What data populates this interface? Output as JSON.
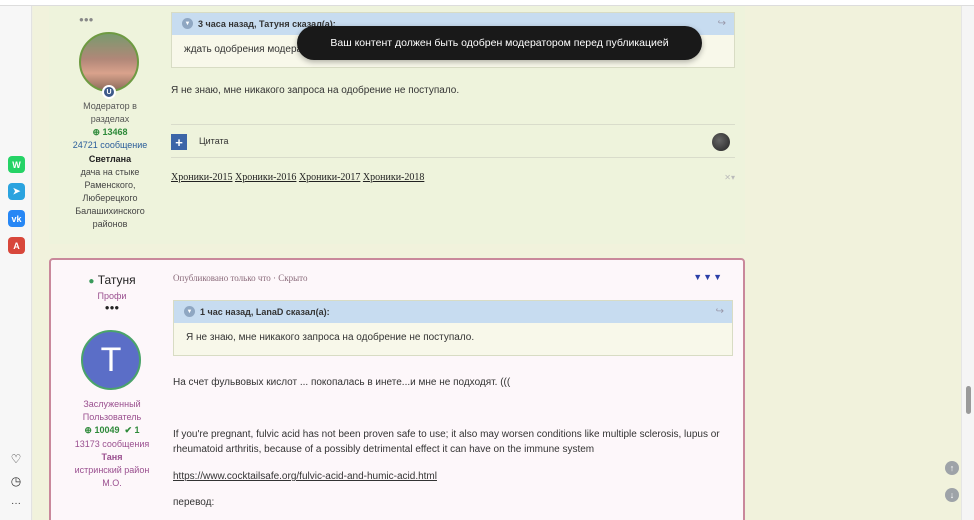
{
  "toast": {
    "message": "Ваш контент должен быть одобрен модератором перед публикацией"
  },
  "sidebar": {
    "apps": [
      {
        "icon": "whatsapp-icon",
        "glyph": "W",
        "color": "#25d366"
      },
      {
        "icon": "telegram-icon",
        "glyph": "➤",
        "color": "#2aa3df"
      },
      {
        "icon": "vk-icon",
        "glyph": "vk",
        "color": "#2787f5"
      },
      {
        "icon": "pdf-icon",
        "glyph": "A",
        "color": "#d8473b"
      }
    ],
    "bottom": [
      {
        "icon": "heart-icon",
        "glyph": "♡"
      },
      {
        "icon": "clock-icon",
        "glyph": "◷"
      },
      {
        "icon": "more-icon",
        "glyph": "···"
      }
    ]
  },
  "post1": {
    "author": {
      "role": "Модератор в разделах",
      "reputation": "13468",
      "posts": "24721 сообщение",
      "name": "Светлана",
      "location": "дача на стыке Раменского, Люберецкого Балашихинского районов"
    },
    "quote": {
      "header": "3 часа назад, Татуня сказал(а):",
      "body": "ждать одобрения модератора"
    },
    "text": "Я не знаю, мне никакого запроса на одобрение не поступало.",
    "editor": {
      "add": "+",
      "cite": "Цитата"
    },
    "signature": [
      "Хроники-2015",
      "Хроники-2016",
      "Хроники-2017",
      "Хроники-2018"
    ]
  },
  "post2": {
    "author": {
      "name": "Татуня",
      "rank": "Профи",
      "dots": "●●●",
      "initial": "T",
      "role": "Заслуженный Пользователь",
      "reputation": "10049",
      "likes": "1",
      "posts": "13173 сообщения",
      "realname": "Таня",
      "location": "истринский район М.О."
    },
    "meta": "Опубликовано только что · Скрыто",
    "quote": {
      "header": "1 час назад, LanaD сказал(а):",
      "body": "Я не знаю, мне никакого запроса на одобрение не поступало."
    },
    "p1": "На счет фульвовых кислот ... покопалась в инете...и мне не подходят. (((",
    "p2": "If you're pregnant, fulvic acid has not been proven safe to use; it also may worsen conditions like multiple sclerosis, lupus or rheumatoid arthritis, because of a possibly detrimental effect it can have on the immune system",
    "link": "https://www.cocktailsafe.org/fulvic-acid-and-humic-acid.html",
    "p3": "перевод:"
  }
}
